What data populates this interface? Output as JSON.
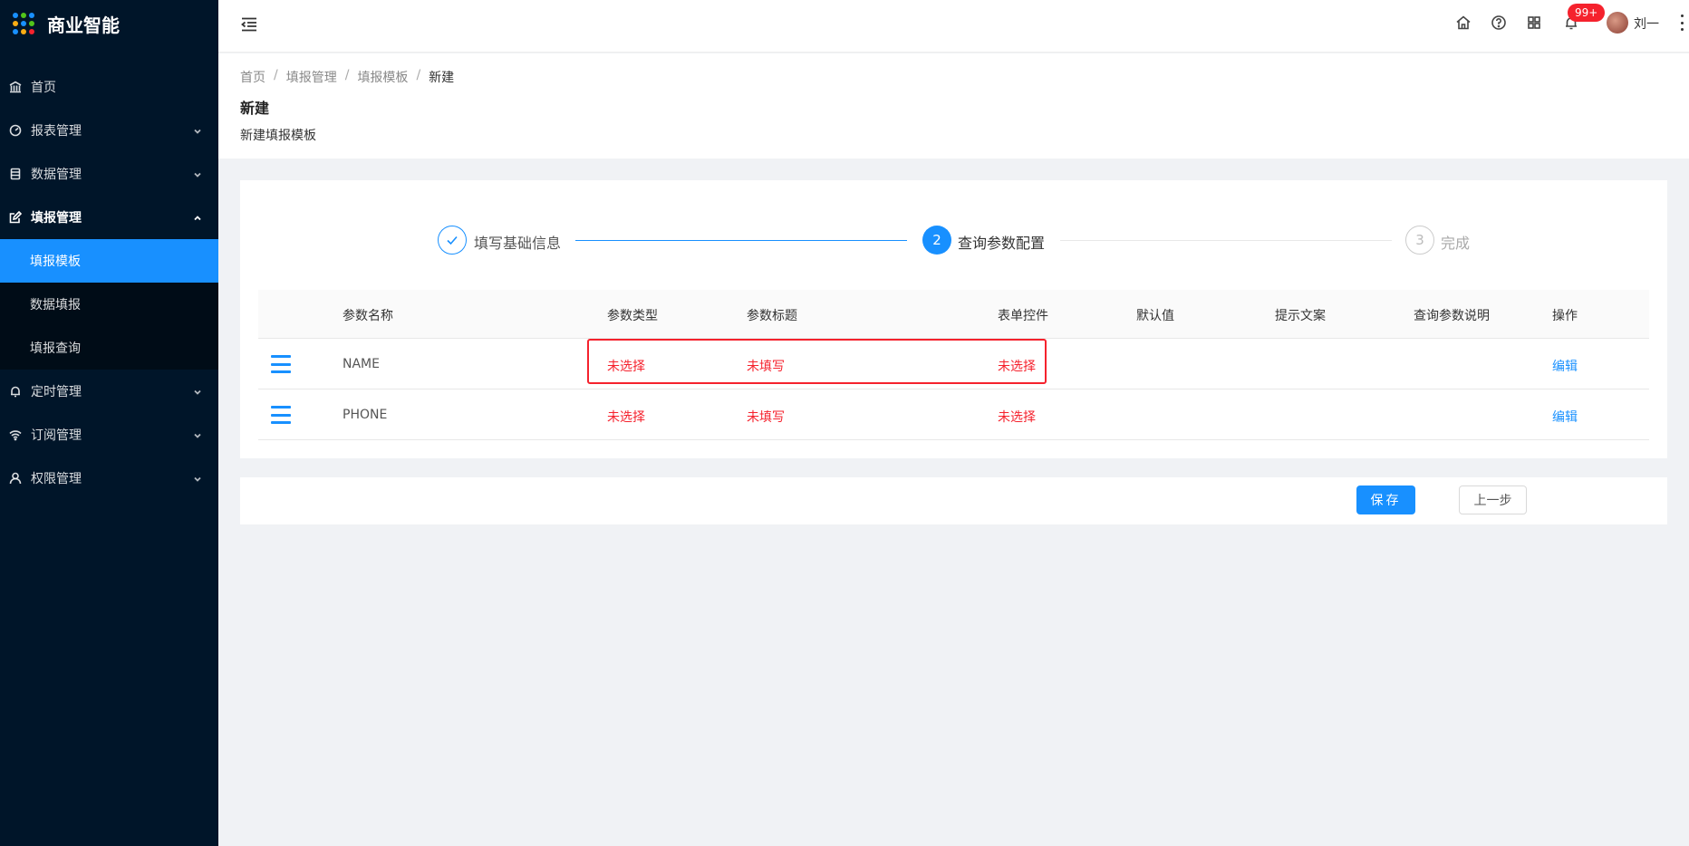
{
  "app": {
    "title": "商业智能"
  },
  "sidebar": {
    "items": [
      {
        "label": "首页"
      },
      {
        "label": "报表管理"
      },
      {
        "label": "数据管理"
      },
      {
        "label": "填报管理"
      },
      {
        "label": "定时管理"
      },
      {
        "label": "订阅管理"
      },
      {
        "label": "权限管理"
      }
    ],
    "submenu": [
      {
        "label": "填报模板"
      },
      {
        "label": "数据填报"
      },
      {
        "label": "填报查询"
      }
    ]
  },
  "header": {
    "notification_count": "99+",
    "user_name": "刘一"
  },
  "breadcrumb": [
    "首页",
    "填报管理",
    "填报模板",
    "新建"
  ],
  "page": {
    "title": "新建",
    "description": "新建填报模板"
  },
  "steps": [
    {
      "index": "1",
      "title": "填写基础信息"
    },
    {
      "index": "2",
      "title": "查询参数配置"
    },
    {
      "index": "3",
      "title": "完成"
    }
  ],
  "table": {
    "headers": [
      "参数名称",
      "参数类型",
      "参数标题",
      "表单控件",
      "默认值",
      "提示文案",
      "查询参数说明",
      "操作"
    ],
    "rows": [
      {
        "name": "NAME",
        "type": "未选择",
        "title": "未填写",
        "control": "未选择",
        "action": "编辑"
      },
      {
        "name": "PHONE",
        "type": "未选择",
        "title": "未填写",
        "control": "未选择",
        "action": "编辑"
      }
    ]
  },
  "footer": {
    "save_label": "保存",
    "prev_label": "上一步"
  },
  "colors": {
    "primary": "#1890ff",
    "sidebar_bg": "#001529",
    "error": "#f5222d"
  }
}
